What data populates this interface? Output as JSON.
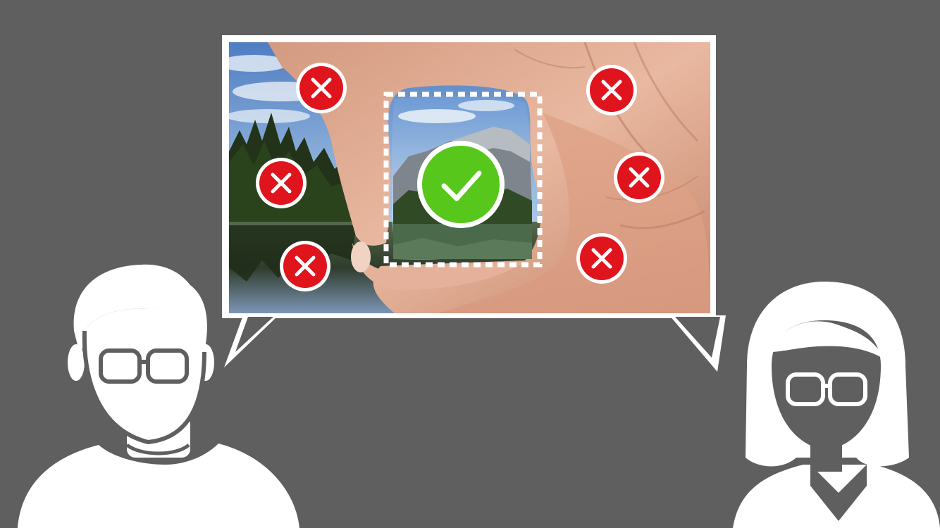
{
  "colors": {
    "background": "#5f5f5f",
    "bubble_border": "#ffffff",
    "figure_fill": "#ffffff",
    "reject_red": "#e0141d",
    "accept_green": "#57c71b",
    "sky_top": "#5b86c8",
    "sky_bottom": "#c9dcef",
    "forest": "#24351c",
    "lake": "#3e4c3a",
    "skin_light": "#e8b79e",
    "skin_shadow": "#b97b63",
    "mountain": "#8a8f96"
  },
  "scene": {
    "description_icons": [
      "person-with-glasses-icon",
      "woman-with-glasses-icon"
    ],
    "bubble_icon": "speech-bubble-icon",
    "selection_icon": "dashed-selection-frame-icon",
    "accept_icon": "checkmark-circle-icon",
    "reject_icon": "x-circle-icon",
    "reject_count": 6,
    "accept_count": 1
  }
}
